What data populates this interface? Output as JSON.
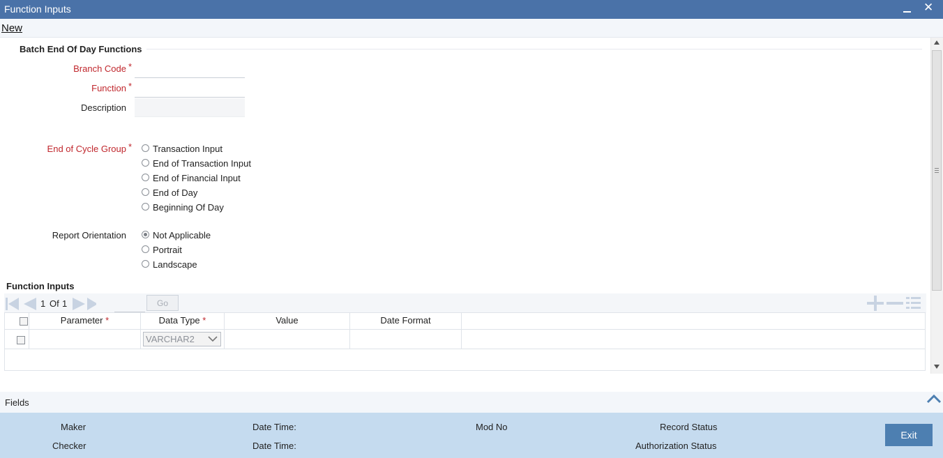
{
  "window": {
    "title": "Function Inputs",
    "minimize_icon": "minimize-icon",
    "close_icon": "close-icon",
    "close_glyph": "✕"
  },
  "menu": {
    "new_label": "New"
  },
  "section": {
    "title": "Batch End Of Day Functions"
  },
  "form": {
    "branch_code": {
      "label": "Branch Code",
      "value": "",
      "required": "*"
    },
    "function": {
      "label": "Function",
      "value": "",
      "required": "*"
    },
    "description": {
      "label": "Description",
      "value": ""
    },
    "end_of_cycle_group": {
      "label": "End of Cycle Group",
      "required": "*",
      "options": [
        "Transaction Input",
        "End of Transaction Input",
        "End of Financial Input",
        "End of Day",
        "Beginning Of Day"
      ],
      "selected": null
    },
    "report_orientation": {
      "label": "Report Orientation",
      "options": [
        "Not Applicable",
        "Portrait",
        "Landscape"
      ],
      "selected": "Not Applicable"
    }
  },
  "grid": {
    "title": "Function Inputs",
    "pager": {
      "current": "1",
      "of_label": "Of",
      "total": "1",
      "page_input": "",
      "go_label": "Go"
    },
    "columns": [
      {
        "label": "Parameter",
        "required": "*"
      },
      {
        "label": "Data Type",
        "required": "*"
      },
      {
        "label": "Value",
        "required": ""
      },
      {
        "label": "Date Format",
        "required": ""
      }
    ],
    "rows": [
      {
        "parameter": "",
        "data_type": "VARCHAR2",
        "value": "",
        "date_format": ""
      }
    ],
    "icons": [
      "first-page-icon",
      "prev-page-icon",
      "next-page-icon",
      "last-page-icon",
      "add-row-icon",
      "delete-row-icon",
      "view-rows-icon"
    ]
  },
  "fields_bar": {
    "label": "Fields",
    "collapse_icon": "chevron-up-icon"
  },
  "footer": {
    "maker": "Maker",
    "checker": "Checker",
    "date_time_1": "Date Time:",
    "date_time_2": "Date Time:",
    "mod_no": "Mod No",
    "record_status": "Record Status",
    "authorization_status": "Authorization Status",
    "exit_label": "Exit"
  },
  "colors": {
    "titlebar": "#4a72a8",
    "footer": "#c5dbef",
    "required": "#c0272d",
    "exit_button": "#4d7fb1"
  }
}
